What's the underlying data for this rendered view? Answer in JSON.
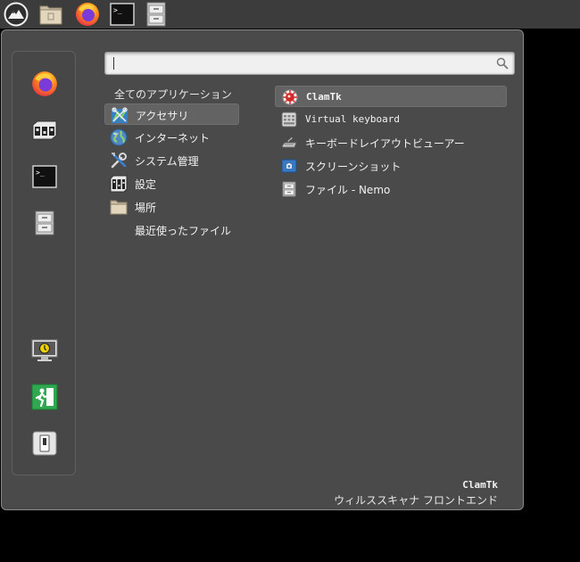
{
  "panel": {
    "launchers": [
      {
        "name": "menu-button",
        "icon": "mountain-logo-icon"
      },
      {
        "name": "home-folder-launcher",
        "icon": "folder-icon"
      },
      {
        "name": "firefox-launcher",
        "icon": "firefox-icon"
      },
      {
        "name": "terminal-launcher",
        "icon": "terminal-icon"
      },
      {
        "name": "file-manager-launcher",
        "icon": "file-cabinet-icon"
      }
    ]
  },
  "favorites": [
    {
      "name": "fav-firefox",
      "icon": "firefox-icon"
    },
    {
      "name": "fav-settings",
      "icon": "control-panel-icon"
    },
    {
      "name": "fav-terminal",
      "icon": "terminal-icon"
    },
    {
      "name": "fav-files",
      "icon": "file-cabinet-icon"
    },
    {
      "name": "fav-lock-screen",
      "icon": "lock-screen-icon"
    },
    {
      "name": "fav-logout",
      "icon": "exit-icon"
    },
    {
      "name": "fav-shutdown",
      "icon": "power-switch-icon"
    }
  ],
  "search": {
    "value": "",
    "placeholder": ""
  },
  "categories": {
    "all_label": "全てのアプリケーション",
    "items": [
      {
        "label": "アクセサリ",
        "icon": "accessories-icon",
        "selected": true
      },
      {
        "label": "インターネット",
        "icon": "globe-icon"
      },
      {
        "label": "システム管理",
        "icon": "tools-icon"
      },
      {
        "label": "設定",
        "icon": "preferences-icon"
      },
      {
        "label": "場所",
        "icon": "folder-icon"
      },
      {
        "label": "最近使ったファイル",
        "icon": ""
      }
    ]
  },
  "apps": [
    {
      "label": "ClamTk",
      "icon": "clamtk-icon",
      "selected": true
    },
    {
      "label": "Virtual keyboard",
      "icon": "keyboard-icon"
    },
    {
      "label": "キーボードレイアウトビューアー",
      "icon": "keyboard-layout-icon"
    },
    {
      "label": "スクリーンショット",
      "icon": "screenshot-icon"
    },
    {
      "label": "ファイル - Nemo",
      "icon": "file-cabinet-icon"
    }
  ],
  "description": {
    "title": "ClamTk",
    "text": "ウィルススキャナ フロントエンド"
  },
  "colors": {
    "panel_bg": "#3c3c3c",
    "menu_bg": "#4a4a4a",
    "selection_bg": "#636363",
    "text": "#f2f2f2"
  }
}
